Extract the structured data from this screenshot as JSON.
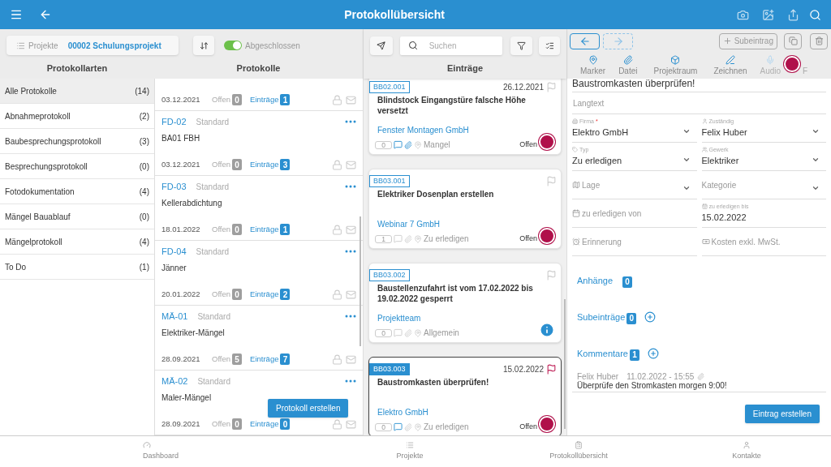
{
  "app_bar": {
    "title": "Protokollübersicht"
  },
  "toolbar": {
    "project_label": "Projekte",
    "project": "00002 Schulungsprojekt",
    "toggle": {
      "label": "Abgeschlossen",
      "on": true
    },
    "search": {
      "placeholder": "Suchen"
    }
  },
  "protokollarten": {
    "title": "Protokollarten",
    "items": [
      {
        "label": "Alle Protokolle",
        "count": "(14)",
        "selected": true
      },
      {
        "label": "Abnahmeprotokoll",
        "count": "(2)",
        "selected": false
      },
      {
        "label": "Baubesprechungsprotokoll",
        "count": "(3)",
        "selected": false
      },
      {
        "label": "Besprechungsprotokoll",
        "count": "(0)",
        "selected": false
      },
      {
        "label": "Fotodokumentation",
        "count": "(4)",
        "selected": false
      },
      {
        "label": "Mängel Bauablauf",
        "count": "(0)",
        "selected": false
      },
      {
        "label": "Mängelprotokoll",
        "count": "(4)",
        "selected": false
      },
      {
        "label": "To Do",
        "count": "(1)",
        "selected": false
      }
    ]
  },
  "protokolle": {
    "title": "Protokolle",
    "create_button": "Protokoll erstellen",
    "items": [
      {
        "date": "03.12.2021",
        "open_label": "Offen",
        "open": "0",
        "entries_label": "Einträge",
        "entries": "1"
      },
      {
        "id": "FD-02",
        "type": "Standard",
        "title": "BA01 FBH",
        "date": "03.12.2021",
        "open_label": "Offen",
        "open": "0",
        "entries_label": "Einträge",
        "entries": "3"
      },
      {
        "id": "FD-03",
        "type": "Standard",
        "title": "Kellerabdichtung",
        "date": "18.01.2022",
        "open_label": "Offen",
        "open": "0",
        "entries_label": "Einträge",
        "entries": "1"
      },
      {
        "id": "FD-04",
        "type": "Standard",
        "title": "Jänner",
        "date": "20.01.2022",
        "open_label": "Offen",
        "open": "0",
        "entries_label": "Einträge",
        "entries": "2"
      },
      {
        "id": "MÄ-01",
        "type": "Standard",
        "title": "Elektriker-Mängel",
        "date": "28.09.2021",
        "open_label": "Offen",
        "open": "5",
        "entries_label": "Einträge",
        "entries": "7"
      },
      {
        "id": "MÄ-02",
        "type": "Standard",
        "title": "Maler-Mängel",
        "date": "28.09.2021",
        "open_label": "Offen",
        "open": "0",
        "entries_label": "Einträge",
        "entries": "0"
      }
    ]
  },
  "eintraege": {
    "title": "Einträge",
    "items": [
      {
        "tag": "BB02.001",
        "date": "26.12.2021",
        "title": "Blindstock Eingangstüre falsche Höhe versetzt",
        "company": "Fenster Montagen GmbH",
        "count": "0",
        "comments": true,
        "attachments": true,
        "category": "Mangel",
        "status": "Offen",
        "kind": "status",
        "selected": false,
        "flagged": false
      },
      {
        "tag": "BB03.001",
        "title": "Elektriker Dosenplan erstellen",
        "company": "Webinar 7 GmbH",
        "count": "1",
        "comments": false,
        "attachments": false,
        "category": "Zu erledigen",
        "status": "Offen",
        "kind": "status",
        "selected": false,
        "flagged": false
      },
      {
        "tag": "BB03.002",
        "title": "Baustellenzufahrt ist vom 17.02.2022 bis 19.02.2022 gesperrt",
        "company": "Projektteam",
        "count": "0",
        "comments": false,
        "attachments": false,
        "category": "Allgemein",
        "kind": "info",
        "selected": false,
        "flagged": false
      },
      {
        "tag": "BB03.003",
        "date": "15.02.2022",
        "title": "Baustromkasten überprüfen!",
        "company": "Elektro GmbH",
        "count": "0",
        "comments": true,
        "attachments": false,
        "category": "Zu erledigen",
        "status": "Offen",
        "kind": "status",
        "selected": true,
        "flagged": true
      }
    ]
  },
  "detail": {
    "subentry_button": "Subeintrag",
    "tools": [
      {
        "label": "Marker",
        "disabled": false
      },
      {
        "label": "Datei",
        "disabled": false
      },
      {
        "label": "Projektraum",
        "disabled": false
      },
      {
        "label": "Zeichnen",
        "disabled": false
      },
      {
        "label": "Audio",
        "disabled": true
      }
    ],
    "tool_cut": "F",
    "title": "Baustromkasten überprüfen!",
    "longtext": {
      "placeholder": "Langtext"
    },
    "fields": [
      {
        "label": "Firma",
        "required_mark": "*",
        "value": "Elektro GmbH",
        "dropdown": true
      },
      {
        "label": "Zuständig",
        "value": "Felix Huber",
        "dropdown": true
      },
      {
        "label": "Typ",
        "value": "Zu erledigen",
        "dropdown": true
      },
      {
        "label": "Gewerk",
        "value": "Elektriker",
        "dropdown": true
      },
      {
        "label": "Lage",
        "dropdown": true
      },
      {
        "label": "Kategorie",
        "dropdown": true
      },
      {
        "label": "zu erledigen von",
        "dropdown": false
      },
      {
        "label": "zu erledigen bis",
        "value": "15.02.2022",
        "dropdown": false
      },
      {
        "label": "Erinnerung",
        "dropdown": false
      },
      {
        "label": "Kosten exkl. MwSt.",
        "dropdown": false
      }
    ],
    "sections": [
      {
        "label": "Anhänge",
        "count": "0",
        "kind": "plain"
      },
      {
        "label": "Subeinträge",
        "count": "0",
        "kind": "addable"
      },
      {
        "label": "Kommentare",
        "count": "1",
        "kind": "addable"
      }
    ],
    "comment": {
      "author": "Felix Huber",
      "time": "11.02.2022 - 15:55",
      "text": "Überprüfe den Stromkasten morgen 9:00!"
    },
    "create_button": "Eintrag erstellen"
  },
  "bottom_nav": [
    {
      "label": "Dashboard"
    },
    {
      "label": "Projekte"
    },
    {
      "label": "Protokollübersicht"
    },
    {
      "label": "Kontakte"
    }
  ]
}
